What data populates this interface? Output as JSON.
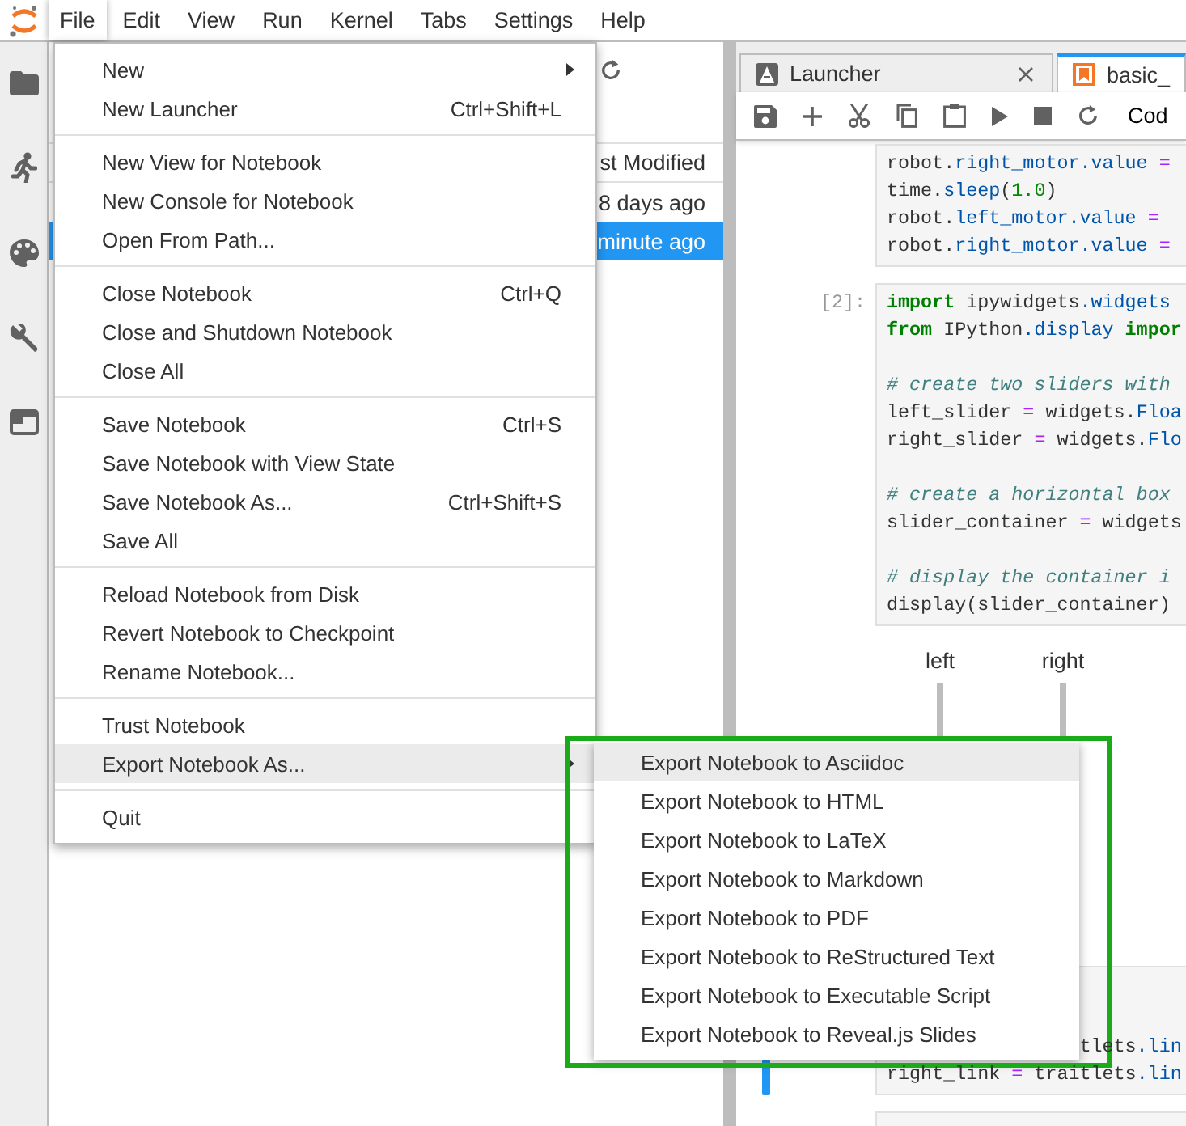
{
  "menubar": [
    {
      "label": "File",
      "selected": true
    },
    {
      "label": "Edit",
      "selected": false
    },
    {
      "label": "View",
      "selected": false
    },
    {
      "label": "Run",
      "selected": false
    },
    {
      "label": "Kernel",
      "selected": false
    },
    {
      "label": "Tabs",
      "selected": false
    },
    {
      "label": "Settings",
      "selected": false
    },
    {
      "label": "Help",
      "selected": false
    }
  ],
  "file_menu": [
    [
      {
        "label": "New",
        "submenu": true,
        "selected": false
      },
      {
        "label": "New Launcher",
        "shortcut": "Ctrl+Shift+L",
        "submenu": false,
        "selected": false
      }
    ],
    [
      {
        "label": "New View for Notebook",
        "submenu": false,
        "selected": false
      },
      {
        "label": "New Console for Notebook",
        "submenu": false,
        "selected": false
      },
      {
        "label": "Open From Path...",
        "submenu": false,
        "selected": false
      }
    ],
    [
      {
        "label": "Close Notebook",
        "shortcut": "Ctrl+Q",
        "submenu": false,
        "selected": false
      },
      {
        "label": "Close and Shutdown Notebook",
        "submenu": false,
        "selected": false
      },
      {
        "label": "Close All",
        "submenu": false,
        "selected": false
      }
    ],
    [
      {
        "label": "Save Notebook",
        "shortcut": "Ctrl+S",
        "submenu": false,
        "selected": false
      },
      {
        "label": "Save Notebook with View State",
        "submenu": false,
        "selected": false
      },
      {
        "label": "Save Notebook As...",
        "shortcut": "Ctrl+Shift+S",
        "submenu": false,
        "selected": false
      },
      {
        "label": "Save All",
        "submenu": false,
        "selected": false
      }
    ],
    [
      {
        "label": "Reload Notebook from Disk",
        "submenu": false,
        "selected": false
      },
      {
        "label": "Revert Notebook to Checkpoint",
        "submenu": false,
        "selected": false
      },
      {
        "label": "Rename Notebook...",
        "submenu": false,
        "selected": false
      }
    ],
    [
      {
        "label": "Trust Notebook",
        "submenu": false,
        "selected": false
      },
      {
        "label": "Export Notebook As...",
        "submenu": true,
        "selected": true
      }
    ],
    [
      {
        "label": "Quit",
        "submenu": false,
        "selected": false
      }
    ]
  ],
  "export_submenu": [
    {
      "label": "Export Notebook to Asciidoc",
      "selected": true
    },
    {
      "label": "Export Notebook to HTML",
      "selected": false
    },
    {
      "label": "Export Notebook to LaTeX",
      "selected": false
    },
    {
      "label": "Export Notebook to Markdown",
      "selected": false
    },
    {
      "label": "Export Notebook to PDF",
      "selected": false
    },
    {
      "label": "Export Notebook to ReStructured Text",
      "selected": false
    },
    {
      "label": "Export Notebook to Executable Script",
      "selected": false
    },
    {
      "label": "Export Notebook to Reveal.js Slides",
      "selected": false
    }
  ],
  "file_browser": {
    "header": "st Modified",
    "rows": [
      {
        "modified": "8 days ago",
        "selected": false
      },
      {
        "modified": "minute ago",
        "selected": true
      }
    ]
  },
  "tabs": [
    {
      "label": "Launcher",
      "kind": "launcher",
      "selected": false
    },
    {
      "label": "basic_",
      "kind": "notebook",
      "selected": true
    }
  ],
  "toolbar": {
    "cell_type": "Cod"
  },
  "cells": [
    {
      "active": false,
      "lines": [
        {
          "tokens": [
            {
              "text": "robot.",
              "kind": "name"
            },
            {
              "text": "right_motor.value",
              "kind": "attr"
            },
            {
              "text": " =",
              "kind": "op"
            }
          ]
        },
        {
          "tokens": [
            {
              "text": "time.",
              "kind": "name"
            },
            {
              "text": "sleep",
              "kind": "attr"
            },
            {
              "text": "(",
              "kind": "name"
            },
            {
              "text": "1.0",
              "kind": "num"
            },
            {
              "text": ")",
              "kind": "name"
            }
          ]
        },
        {
          "tokens": [
            {
              "text": "robot.",
              "kind": "name"
            },
            {
              "text": "left_motor.value",
              "kind": "attr"
            },
            {
              "text": " =",
              "kind": "op"
            }
          ]
        },
        {
          "tokens": [
            {
              "text": "robot.",
              "kind": "name"
            },
            {
              "text": "right_motor.value",
              "kind": "attr"
            },
            {
              "text": " =",
              "kind": "op"
            }
          ]
        }
      ]
    },
    {
      "active": false,
      "prompt": "[2]:",
      "lines": [
        {
          "tokens": [
            {
              "text": "import",
              "kind": "keyword"
            },
            {
              "text": " ipywidgets",
              "kind": "name"
            },
            {
              "text": ".widgets",
              "kind": "attr"
            }
          ]
        },
        {
          "tokens": [
            {
              "text": "from",
              "kind": "keyword"
            },
            {
              "text": " IPython",
              "kind": "name"
            },
            {
              "text": ".display ",
              "kind": "attr"
            },
            {
              "text": "impor",
              "kind": "keyword"
            }
          ]
        },
        {
          "kind": "blank"
        },
        {
          "tokens": [
            {
              "text": "# create two sliders with",
              "kind": "comment"
            }
          ]
        },
        {
          "tokens": [
            {
              "text": "left_slider ",
              "kind": "name"
            },
            {
              "text": "=",
              "kind": "op"
            },
            {
              "text": " widgets.",
              "kind": "name"
            },
            {
              "text": "Floa",
              "kind": "attr"
            }
          ]
        },
        {
          "tokens": [
            {
              "text": "right_slider ",
              "kind": "name"
            },
            {
              "text": "=",
              "kind": "op"
            },
            {
              "text": " widgets.",
              "kind": "name"
            },
            {
              "text": "Flo",
              "kind": "attr"
            }
          ]
        },
        {
          "kind": "blank"
        },
        {
          "tokens": [
            {
              "text": "# create a horizontal box",
              "kind": "comment"
            }
          ]
        },
        {
          "tokens": [
            {
              "text": "slider_container ",
              "kind": "name"
            },
            {
              "text": "=",
              "kind": "op"
            },
            {
              "text": " widgets",
              "kind": "name"
            }
          ]
        },
        {
          "kind": "blank"
        },
        {
          "tokens": [
            {
              "text": "# display the container i",
              "kind": "comment"
            }
          ]
        },
        {
          "tokens": [
            {
              "text": "display(slider_container)",
              "kind": "name"
            }
          ]
        }
      ],
      "output": {
        "sliders": [
          {
            "label": "left"
          },
          {
            "label": "right"
          }
        ]
      }
    },
    {
      "active": true,
      "lines": [
        {
          "tokens": [
            {
              "text": "tlets",
              "kind": "name"
            },
            {
              "text": ".lin",
              "kind": "attr"
            }
          ],
          "kind": "covered"
        },
        {
          "tokens": [
            {
              "text": "right_link ",
              "kind": "name"
            },
            {
              "text": "=",
              "kind": "op"
            },
            {
              "text": " traitlets",
              "kind": "name"
            },
            {
              "text": ".lin",
              "kind": "attr"
            }
          ]
        }
      ]
    }
  ]
}
